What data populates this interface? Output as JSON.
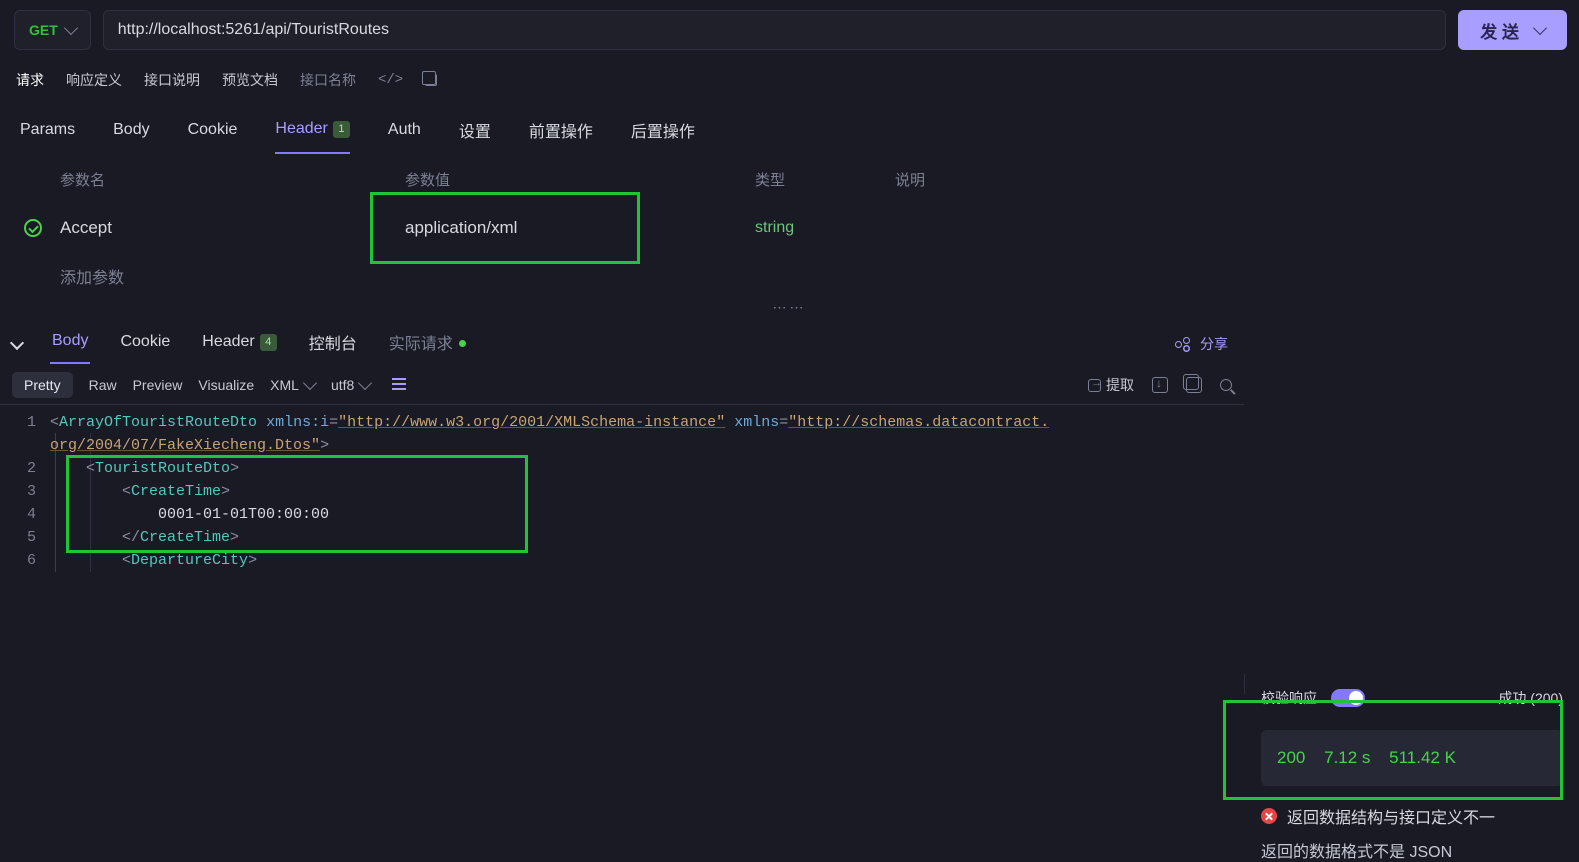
{
  "request": {
    "method": "GET",
    "url": "http://localhost:5261/api/TouristRoutes",
    "send_label": "发 送"
  },
  "sub_tabs": {
    "items": [
      "请求",
      "响应定义",
      "接口说明",
      "预览文档"
    ],
    "placeholder": "接口名称"
  },
  "req_tabs": {
    "params": "Params",
    "body": "Body",
    "cookie": "Cookie",
    "header": "Header",
    "header_count": "1",
    "auth": "Auth",
    "settings": "设置",
    "pre": "前置操作",
    "post": "后置操作"
  },
  "headers_table": {
    "cols": {
      "name": "参数名",
      "value": "参数值",
      "type": "类型",
      "desc": "说明"
    },
    "rows": [
      {
        "name": "Accept",
        "value": "application/xml",
        "type": "string",
        "desc": ""
      }
    ],
    "add": "添加参数"
  },
  "resp_tabs": {
    "body": "Body",
    "cookie": "Cookie",
    "header": "Header",
    "header_count": "4",
    "console": "控制台",
    "actual": "实际请求",
    "share": "分享"
  },
  "side": {
    "verify": "校验响应",
    "success": "成功 (200)",
    "status_code": "200",
    "time": "7.12 s",
    "size": "511.42 K",
    "err1": "返回数据结构与接口定义不一",
    "err2": "返回的数据格式不是 JSON"
  },
  "toolbar": {
    "pretty": "Pretty",
    "raw": "Raw",
    "preview": "Preview",
    "visualize": "Visualize",
    "format": "XML",
    "encoding": "utf8",
    "extract": "提取"
  },
  "code": {
    "l1a": "ArrayOfTouristRouteDto",
    "l1b": "xmlns:i",
    "l1c": "http://www.w3.org/2001/XMLSchema-instance",
    "l1d": "xmlns",
    "l1e": "http://schemas.datacontract.",
    "l1f": "org/2004/07/FakeXiecheng.Dtos",
    "l2": "TouristRouteDto",
    "l3": "CreateTime",
    "l4": "0001-01-01T00:00:00",
    "l5": "CreateTime",
    "l6": "DepartureCity"
  }
}
